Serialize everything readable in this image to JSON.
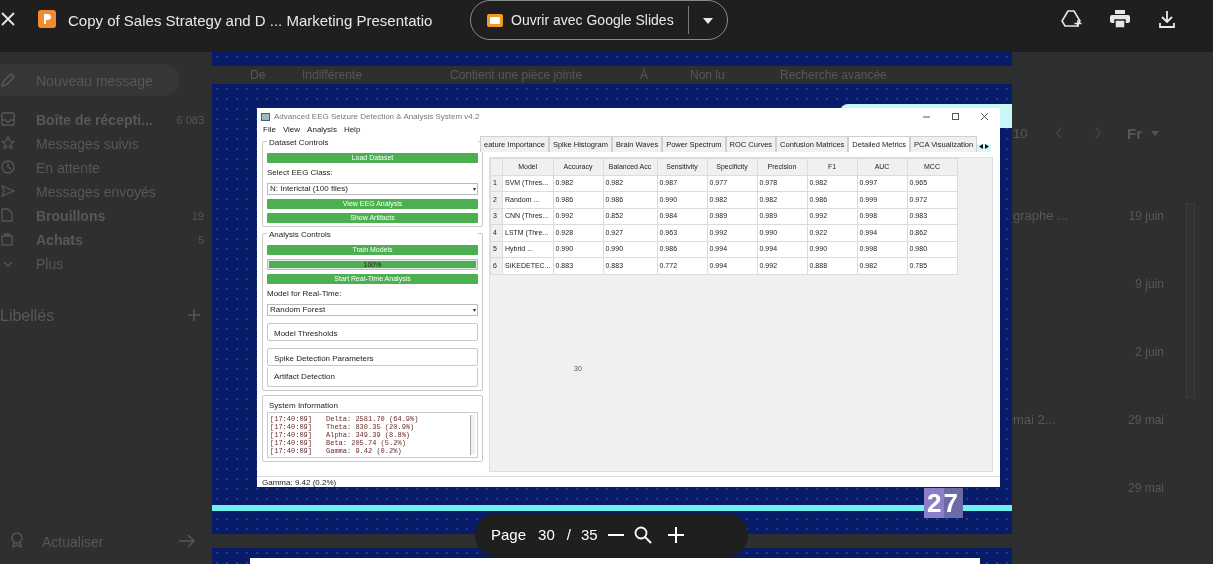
{
  "viewer": {
    "file_title": "Copy of Sales Strategy and D ... Marketing Presentatio",
    "open_button": "Ouvrir avec Google Slides"
  },
  "mail_background": {
    "compose": "Nouveau message",
    "folders": [
      {
        "label": "Boîte de récepti...",
        "count": "6 083",
        "unread": true
      },
      {
        "label": "Messages suivis",
        "unread": false
      },
      {
        "label": "En attente",
        "unread": false
      },
      {
        "label": "Messages envoyés",
        "unread": false
      },
      {
        "label": "Brouillons",
        "count": "19",
        "unread": true
      },
      {
        "label": "Achats",
        "count": "5",
        "unread": true
      }
    ],
    "more": "Plus",
    "labels_heading": "Libellés",
    "upgrade": "Actualiser",
    "filters": [
      "De",
      "Indifférente",
      "Contient une pièce jointe",
      "À",
      "Non lu",
      "Recherche avancée"
    ],
    "pager": {
      "count": "10",
      "sort": "Fr"
    },
    "messages": [
      {
        "subject": "graphe ...",
        "date": "19 juin"
      },
      {
        "date": "9 juin"
      },
      {
        "date": "2 juin"
      },
      {
        "subject": "mai 2...",
        "date": "29 mai"
      },
      {
        "date": "29 mai"
      }
    ]
  },
  "slide": {
    "page_number": "27"
  },
  "app": {
    "title": "Advanced EEG Seizure Detection & Analysis System v4.2",
    "menu": [
      "File",
      "View",
      "Analysis",
      "Help"
    ],
    "dataset_controls": {
      "heading": "Dataset Controls",
      "load_button": "Load Dataset",
      "class_label": "Select EEG Class:",
      "class_value": "N: Interictal (100 files)",
      "view_button": "View EEG Analysis",
      "artifacts_button": "Show Artifacts"
    },
    "analysis_controls": {
      "heading": "Analysis Controls",
      "train_button": "Train Models",
      "progress": {
        "level": 1,
        "text": "100%"
      },
      "realtime_button": "Start Real-Time Analysis",
      "model_label": "Model for Real-Time:",
      "model_value": "Random Forest",
      "sections": [
        "Model Thresholds",
        "Spike Detection Parameters",
        "Artifact Detection"
      ]
    },
    "system_info": {
      "heading": "System Information",
      "log": [
        {
          "time": "[17:40:09]",
          "message": "Delta: 2581.70 (64.9%)"
        },
        {
          "time": "[17:40:09]",
          "message": "Theta: 830.35 (20.9%)"
        },
        {
          "time": "[17:40:09]",
          "message": "Alpha: 349.39 (8.8%)"
        },
        {
          "time": "[17:40:09]",
          "message": "Beta: 205.74 (5.2%)"
        },
        {
          "time": "[17:40:09]",
          "message": "Gamma: 9.42 (0.2%)"
        }
      ]
    },
    "tabs": [
      {
        "label": "eature Importance",
        "selected": false
      },
      {
        "label": "Spike Histogram",
        "selected": false
      },
      {
        "label": "Brain Waves",
        "selected": false
      },
      {
        "label": "Power Spectrum",
        "selected": false
      },
      {
        "label": "ROC Curves",
        "selected": false
      },
      {
        "label": "Confusion Matrices",
        "selected": false
      },
      {
        "label": "Detailed Metrics",
        "selected": true
      },
      {
        "label": "PCA Visualization",
        "selected": false
      }
    ],
    "table": {
      "columns": [
        "Model",
        "Accuracy",
        "Balanced Acc",
        "Sensitivity",
        "Specificity",
        "Precision",
        "F1",
        "AUC",
        "MCC"
      ],
      "rows": [
        {
          "index": "1",
          "cells": [
            "SVM (Thres...",
            "0.982",
            "0.982",
            "0.987",
            "0.977",
            "0.978",
            "0.982",
            "0.997",
            "0.965"
          ]
        },
        {
          "index": "2",
          "cells": [
            "Random ...",
            "0.986",
            "0.986",
            "0.990",
            "0.982",
            "0.982",
            "0.986",
            "0.999",
            "0.972"
          ]
        },
        {
          "index": "3",
          "cells": [
            "CNN (Thres...",
            "0.992",
            "0.852",
            "0.984",
            "0.989",
            "0.989",
            "0.992",
            "0.998",
            "0.983"
          ]
        },
        {
          "index": "4",
          "cells": [
            "LSTM (Thre...",
            "0.928",
            "0.927",
            "0.963",
            "0.992",
            "0.990",
            "0.922",
            "0.994",
            "0.862"
          ]
        },
        {
          "index": "5",
          "cells": [
            "Hybrid ...",
            "0.990",
            "0.990",
            "0.986",
            "0.994",
            "0.994",
            "0.990",
            "0.998",
            "0.980"
          ]
        },
        {
          "index": "6",
          "cells": [
            "SIKEDETEC...",
            "0.883",
            "0.883",
            "0.772",
            "0.994",
            "0.992",
            "0.888",
            "0.982",
            "0.785"
          ]
        }
      ]
    },
    "canvas_label": "30",
    "status": "Gamma: 9.42 (0.2%)"
  },
  "page_toolbar": {
    "label": "Page",
    "current": "30",
    "separator": "/",
    "total": "35"
  }
}
